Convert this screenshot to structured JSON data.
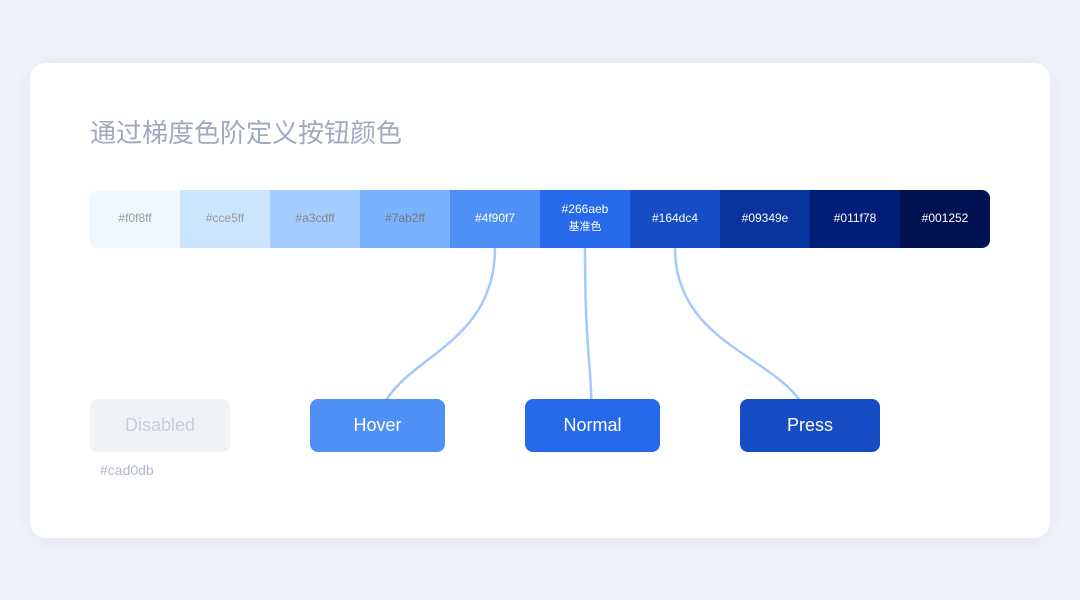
{
  "title": "通过梯度色阶定义按钮颜色",
  "palette": [
    {
      "hex": "#f0f8ff",
      "bg": "#f0f8ff",
      "text": "#999",
      "label": ""
    },
    {
      "hex": "#cce5ff",
      "bg": "#cce5ff",
      "text": "#999",
      "label": ""
    },
    {
      "hex": "#a3cdff",
      "bg": "#a3cdff",
      "text": "#888",
      "label": ""
    },
    {
      "hex": "#7ab2ff",
      "bg": "#7ab2ff",
      "text": "#777",
      "label": ""
    },
    {
      "hex": "#4f90f7",
      "bg": "#4f90f7",
      "text": "#fff",
      "label": ""
    },
    {
      "hex": "#266aeb",
      "bg": "#266aeb",
      "text": "#fff",
      "label": "基准色"
    },
    {
      "hex": "#164dc4",
      "bg": "#164dc4",
      "text": "#fff",
      "label": ""
    },
    {
      "hex": "#09349e",
      "bg": "#09349e",
      "text": "#fff",
      "label": ""
    },
    {
      "hex": "#011f78",
      "bg": "#011f78",
      "text": "#fff",
      "label": ""
    },
    {
      "hex": "#001252",
      "bg": "#001252",
      "text": "#fff",
      "label": ""
    }
  ],
  "buttons": {
    "disabled": {
      "label": "Disabled",
      "color_hint": "#cad0db"
    },
    "hover": {
      "label": "Hover"
    },
    "normal": {
      "label": "Normal"
    },
    "press": {
      "label": "Press"
    }
  },
  "disabled_hex": "#cad0db"
}
